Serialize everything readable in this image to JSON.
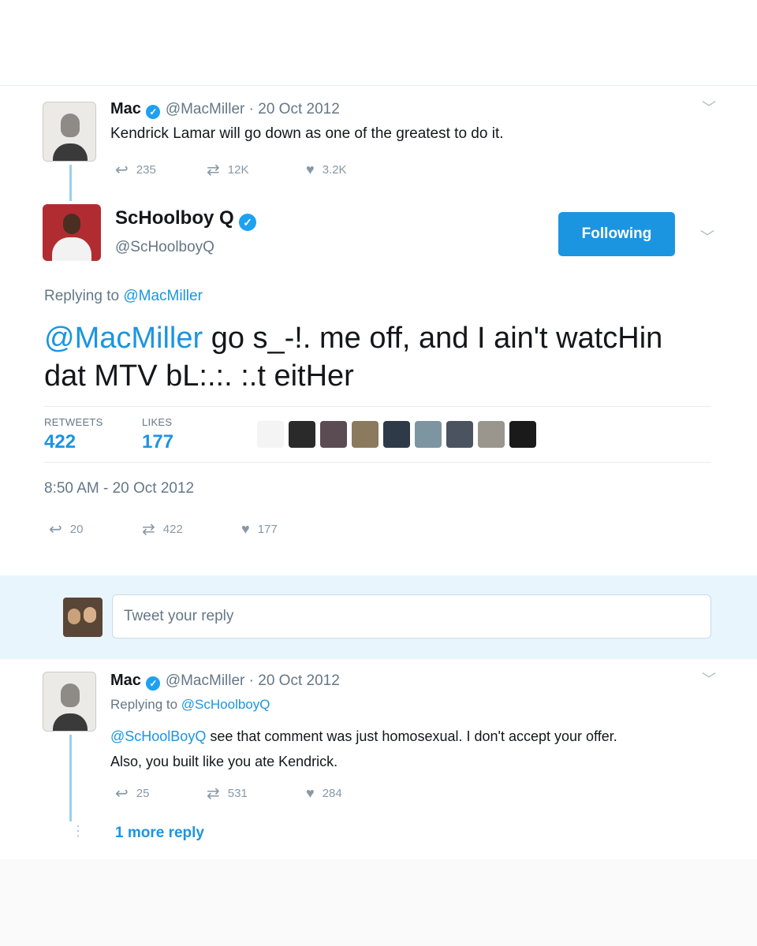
{
  "tweet1": {
    "name": "Mac",
    "handle": "@MacMiller · 20 Oct 2012",
    "text": "Kendrick Lamar will go down as one of the greatest to do it.",
    "replies": "235",
    "retweets": "12K",
    "likes": "3.2K"
  },
  "main_tweet": {
    "name": "ScHoolboy Q",
    "handle": "@ScHoolboyQ",
    "follow_label": "Following",
    "replying_prefix": "Replying to ",
    "replying_to": "@MacMiller",
    "mention": "@MacMiller",
    "text_line1": " go s_-!. me off, and I ain't watcHin",
    "text_line2": "dat MTV bL:.:. :.t eitHer",
    "retweets_label": "RETWEETS",
    "retweets_count": "422",
    "likes_label": "LIKES",
    "likes_count": "177",
    "timestamp": "8:50 AM - 20 Oct 2012",
    "replies": "20",
    "retweets": "422",
    "likes": "177",
    "liker_colors": [
      "#f4f4f4",
      "#2a2a2a",
      "#5b4b52",
      "#8c7a5e",
      "#2f3a48",
      "#7d95a1",
      "#4b5360",
      "#9a958d",
      "#1a1a1a"
    ]
  },
  "reply_box": {
    "placeholder": "Tweet your reply"
  },
  "tweet3": {
    "name": "Mac",
    "handle": "@MacMiller · 20 Oct 2012",
    "replying_prefix": "Replying to ",
    "replying_to": "@ScHoolboyQ",
    "mention": "@ScHoolBoyQ",
    "text_line1": " see that comment was just homosexual. I don't accept your offer.",
    "text_line2": "Also, you built like you ate Kendrick.",
    "replies": "25",
    "retweets": "531",
    "likes": "284",
    "more_replies": "1 more reply"
  },
  "icons": {
    "reply": "reply-icon",
    "retweet": "retweet-icon",
    "like": "heart-icon",
    "chevron": "chevron-down-icon",
    "verified": "verified-badge-icon"
  },
  "colors": {
    "accent": "#1b95e0",
    "muted": "#657786",
    "reply_band": "#e8f5fd"
  }
}
